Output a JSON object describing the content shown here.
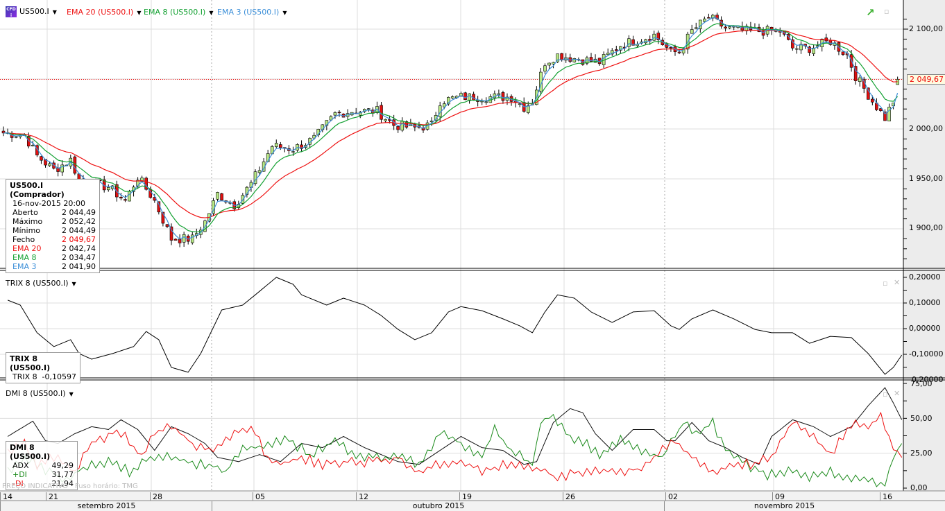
{
  "header": {
    "symbol": "US500.I",
    "ema20": "EMA 20 (US500.I)",
    "ema8": "EMA 8 (US500.I)",
    "ema3": "EMA 3 (US500.I)"
  },
  "colors": {
    "ema20": "#ee1111",
    "ema8": "#11a030",
    "ema3": "#3a8ed8",
    "up": "#b8e986",
    "down": "#e01010",
    "adx": "#111111",
    "pdi": "#1a8a1a",
    "mdi": "#ee1111"
  },
  "price_tag": "2 049,67",
  "legend": {
    "title": "US500.I (Comprador)",
    "date": "16-nov-2015 20:00",
    "rows": [
      {
        "k": "Aberto",
        "v": "2 044,49"
      },
      {
        "k": "Máximo",
        "v": "2 052,42"
      },
      {
        "k": "Mínimo",
        "v": "2 044,49"
      },
      {
        "k": "Fecho",
        "v": "2 049,67"
      },
      {
        "k": "EMA 20",
        "v": "2 042,74"
      },
      {
        "k": "EMA 8",
        "v": "2 034,47"
      },
      {
        "k": "EMA 3",
        "v": "2 041,90"
      }
    ]
  },
  "trix": {
    "title": "TRIX 8 (US500.I)",
    "legend_title": "TRIX 8 (US500.I)",
    "legend_key": "TRIX 8",
    "legend_val": "-0,10597"
  },
  "dmi": {
    "title": "DMI 8 (US500.I)",
    "legend_title": "DMI 8 (US500.I)",
    "adx_label": "ADX",
    "adx": "49,29",
    "pdi_label": "+DI",
    "pdi": "31,77",
    "mdi_label": "-DI",
    "mdi": "21,94"
  },
  "footer": {
    "indicative": "PREÇO INDICATIVO",
    "timezone": "Fuso horário: TMG"
  },
  "axes": {
    "price": [
      "2 100,00",
      "2 050,00",
      "2 000,00",
      "1 950,00",
      "1 900,00"
    ],
    "trix": [
      "0,20000",
      "0,10000",
      "0,00000",
      "-0,10000",
      "-0,20000"
    ],
    "dmi": [
      "75,00",
      "50,00",
      "25,00",
      "0,00"
    ]
  },
  "time_axis": {
    "days": [
      "14",
      "21",
      "28",
      "05",
      "12",
      "19",
      "26",
      "02",
      "09",
      "16"
    ],
    "months": [
      "setembro 2015",
      "outubro 2015",
      "novembro 2015"
    ]
  },
  "chart_data": [
    {
      "type": "candlestick",
      "title": "US500.I",
      "ylim": [
        1860,
        2120
      ],
      "price_anchors": [
        [
          0,
          1996
        ],
        [
          5,
          1994
        ],
        [
          8,
          1973
        ],
        [
          12,
          1959
        ],
        [
          16,
          1969
        ],
        [
          18,
          1949
        ],
        [
          21,
          1945
        ],
        [
          25,
          1942
        ],
        [
          29,
          1928
        ],
        [
          32,
          1952
        ],
        [
          36,
          1928
        ],
        [
          40,
          1890
        ],
        [
          45,
          1890
        ],
        [
          48,
          1907
        ],
        [
          51,
          1935
        ],
        [
          55,
          1924
        ],
        [
          59,
          1945
        ],
        [
          64,
          1983
        ],
        [
          69,
          1980
        ],
        [
          74,
          1990
        ],
        [
          79,
          2015
        ],
        [
          83,
          2018
        ],
        [
          89,
          2018
        ],
        [
          93,
          2004
        ],
        [
          98,
          2001
        ],
        [
          102,
          2004
        ],
        [
          104,
          2028
        ],
        [
          109,
          2032
        ],
        [
          116,
          2032
        ],
        [
          121,
          2032
        ],
        [
          124,
          2022
        ],
        [
          126,
          2028
        ],
        [
          129,
          2067
        ],
        [
          132,
          2074
        ],
        [
          137,
          2070
        ],
        [
          142,
          2067
        ],
        [
          147,
          2084
        ],
        [
          150,
          2088
        ],
        [
          155,
          2094
        ],
        [
          159,
          2077
        ],
        [
          161,
          2077
        ],
        [
          164,
          2098
        ],
        [
          168,
          2112
        ],
        [
          172,
          2101
        ],
        [
          177,
          2098
        ],
        [
          182,
          2098
        ],
        [
          185,
          2098
        ],
        [
          188,
          2081
        ],
        [
          192,
          2081
        ],
        [
          197,
          2088
        ],
        [
          201,
          2074
        ],
        [
          203,
          2053
        ],
        [
          207,
          2028
        ],
        [
          210,
          2011
        ],
        [
          212,
          2028
        ],
        [
          213,
          2049.67
        ]
      ],
      "last": {
        "open": 2044.49,
        "high": 2052.42,
        "low": 2044.49,
        "close": 2049.67
      }
    },
    {
      "type": "line",
      "title": "TRIX 8",
      "ylim": [
        -0.2,
        0.2
      ],
      "points": [
        [
          1,
          0.111
        ],
        [
          4,
          0.092
        ],
        [
          8,
          -0.016
        ],
        [
          12,
          -0.07
        ],
        [
          16,
          -0.043
        ],
        [
          18,
          -0.097
        ],
        [
          21,
          -0.119
        ],
        [
          26,
          -0.097
        ],
        [
          31,
          -0.07
        ],
        [
          34,
          -0.011
        ],
        [
          37,
          -0.043
        ],
        [
          40,
          -0.151
        ],
        [
          44,
          -0.17
        ],
        [
          47,
          -0.097
        ],
        [
          52,
          0.073
        ],
        [
          57,
          0.092
        ],
        [
          60,
          0.132
        ],
        [
          65,
          0.2
        ],
        [
          69,
          0.173
        ],
        [
          71,
          0.132
        ],
        [
          77,
          0.092
        ],
        [
          81,
          0.119
        ],
        [
          86,
          0.092
        ],
        [
          90,
          0.051
        ],
        [
          94,
          -0.003
        ],
        [
          98,
          -0.043
        ],
        [
          102,
          -0.016
        ],
        [
          106,
          0.065
        ],
        [
          109,
          0.086
        ],
        [
          114,
          0.07
        ],
        [
          119,
          0.038
        ],
        [
          123,
          0.011
        ],
        [
          126,
          -0.016
        ],
        [
          129,
          0.065
        ],
        [
          132,
          0.132
        ],
        [
          136,
          0.119
        ],
        [
          140,
          0.065
        ],
        [
          145,
          0.024
        ],
        [
          150,
          0.065
        ],
        [
          155,
          0.07
        ],
        [
          159,
          0.011
        ],
        [
          161,
          -0.003
        ],
        [
          164,
          0.038
        ],
        [
          169,
          0.073
        ],
        [
          174,
          0.038
        ],
        [
          179,
          -0.003
        ],
        [
          183,
          -0.016
        ],
        [
          188,
          -0.016
        ],
        [
          192,
          -0.057
        ],
        [
          197,
          -0.03
        ],
        [
          202,
          -0.035
        ],
        [
          206,
          -0.097
        ],
        [
          210,
          -0.178
        ],
        [
          212,
          -0.151
        ],
        [
          214,
          -0.103
        ]
      ]
    },
    {
      "type": "line",
      "title": "DMI 8",
      "ylim": [
        0,
        75
      ],
      "series": [
        {
          "name": "ADX",
          "points": [
            [
              1,
              37
            ],
            [
              7,
              48
            ],
            [
              10,
              34
            ],
            [
              13,
              32
            ],
            [
              17,
              39
            ],
            [
              21,
              44
            ],
            [
              25,
              42
            ],
            [
              28,
              49
            ],
            [
              32,
              42
            ],
            [
              36,
              27
            ],
            [
              40,
              44
            ],
            [
              44,
              39
            ],
            [
              48,
              32
            ],
            [
              51,
              22
            ],
            [
              56,
              19
            ],
            [
              61,
              24
            ],
            [
              66,
              19
            ],
            [
              71,
              32
            ],
            [
              76,
              29
            ],
            [
              81,
              37
            ],
            [
              86,
              29
            ],
            [
              90,
              24
            ],
            [
              94,
              19
            ],
            [
              99,
              17
            ],
            [
              104,
              27
            ],
            [
              109,
              37
            ],
            [
              114,
              29
            ],
            [
              119,
              27
            ],
            [
              124,
              17
            ],
            [
              127,
              19
            ],
            [
              131,
              47
            ],
            [
              135,
              57
            ],
            [
              138,
              54
            ],
            [
              141,
              39
            ],
            [
              145,
              27
            ],
            [
              150,
              42
            ],
            [
              155,
              42
            ],
            [
              158,
              34
            ],
            [
              160,
              34
            ],
            [
              164,
              47
            ],
            [
              168,
              34
            ],
            [
              172,
              29
            ],
            [
              176,
              22
            ],
            [
              180,
              17
            ],
            [
              183,
              37
            ],
            [
              188,
              49
            ],
            [
              193,
              44
            ],
            [
              197,
              37
            ],
            [
              202,
              44
            ],
            [
              206,
              59
            ],
            [
              210,
              72
            ],
            [
              212,
              61
            ],
            [
              214,
              49
            ]
          ]
        },
        {
          "name": "+DI",
          "points": [
            [
              1,
              12
            ],
            [
              5,
              22
            ],
            [
              10,
              12
            ],
            [
              15,
              7
            ],
            [
              20,
              16
            ],
            [
              25,
              19
            ],
            [
              30,
              12
            ],
            [
              35,
              22
            ],
            [
              40,
              22
            ],
            [
              45,
              17
            ],
            [
              50,
              17
            ],
            [
              53,
              12
            ],
            [
              57,
              27
            ],
            [
              63,
              32
            ],
            [
              68,
              34
            ],
            [
              73,
              24
            ],
            [
              79,
              34
            ],
            [
              84,
              22
            ],
            [
              89,
              22
            ],
            [
              94,
              22
            ],
            [
              99,
              17
            ],
            [
              104,
              39
            ],
            [
              109,
              32
            ],
            [
              114,
              22
            ],
            [
              117,
              42
            ],
            [
              121,
              27
            ],
            [
              126,
              17
            ],
            [
              128,
              47
            ],
            [
              131,
              52
            ],
            [
              135,
              37
            ],
            [
              139,
              32
            ],
            [
              142,
              22
            ],
            [
              147,
              34
            ],
            [
              152,
              27
            ],
            [
              157,
              22
            ],
            [
              162,
              47
            ],
            [
              165,
              39
            ],
            [
              169,
              47
            ],
            [
              172,
              27
            ],
            [
              177,
              17
            ],
            [
              182,
              9
            ],
            [
              187,
              12
            ],
            [
              192,
              7
            ],
            [
              197,
              12
            ],
            [
              202,
              7
            ],
            [
              207,
              4
            ],
            [
              210,
              4
            ],
            [
              212,
              22
            ],
            [
              214,
              32
            ]
          ]
        },
        {
          "name": "-DI",
          "points": [
            [
              1,
              27
            ],
            [
              5,
              32
            ],
            [
              8,
              17
            ],
            [
              12,
              22
            ],
            [
              17,
              12
            ],
            [
              21,
              32
            ],
            [
              26,
              39
            ],
            [
              29,
              37
            ],
            [
              33,
              22
            ],
            [
              36,
              39
            ],
            [
              40,
              44
            ],
            [
              45,
              32
            ],
            [
              50,
              27
            ],
            [
              55,
              39
            ],
            [
              59,
              44
            ],
            [
              63,
              22
            ],
            [
              66,
              17
            ],
            [
              71,
              22
            ],
            [
              76,
              17
            ],
            [
              83,
              19
            ],
            [
              89,
              19
            ],
            [
              94,
              22
            ],
            [
              99,
              12
            ],
            [
              104,
              17
            ],
            [
              109,
              19
            ],
            [
              114,
              12
            ],
            [
              119,
              17
            ],
            [
              126,
              14
            ],
            [
              129,
              12
            ],
            [
              132,
              7
            ],
            [
              137,
              12
            ],
            [
              142,
              14
            ],
            [
              147,
              12
            ],
            [
              152,
              14
            ],
            [
              157,
              27
            ],
            [
              160,
              34
            ],
            [
              164,
              22
            ],
            [
              169,
              12
            ],
            [
              174,
              17
            ],
            [
              179,
              17
            ],
            [
              183,
              22
            ],
            [
              188,
              47
            ],
            [
              192,
              39
            ],
            [
              197,
              24
            ],
            [
              202,
              47
            ],
            [
              206,
              44
            ],
            [
              209,
              52
            ],
            [
              212,
              29
            ],
            [
              214,
              22
            ]
          ]
        }
      ]
    }
  ]
}
